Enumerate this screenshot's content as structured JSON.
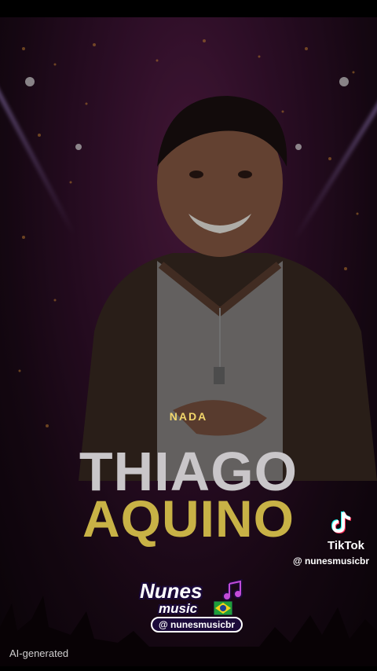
{
  "overlay": {
    "lyric_line": "NADA",
    "title_line1": "THIAGO",
    "title_line2": "AQUINO"
  },
  "tiktok": {
    "icon": "tiktok-logo-icon",
    "name": "TikTok",
    "handle": "@ nunesmusicbr"
  },
  "channel_badge": {
    "line1": "Nunes",
    "line2": "music",
    "handle": "@ nunesmusicbr",
    "icons": [
      "music-note-icon",
      "brazil-flag-icon"
    ]
  },
  "footer": {
    "ai_label": "AI-generated"
  },
  "colors": {
    "background": "#000000",
    "stage_purple": "#5a1f4a",
    "lyric": "#f2d66b",
    "title_silver": "#c9c6c9",
    "title_gold": "#c8b246"
  }
}
